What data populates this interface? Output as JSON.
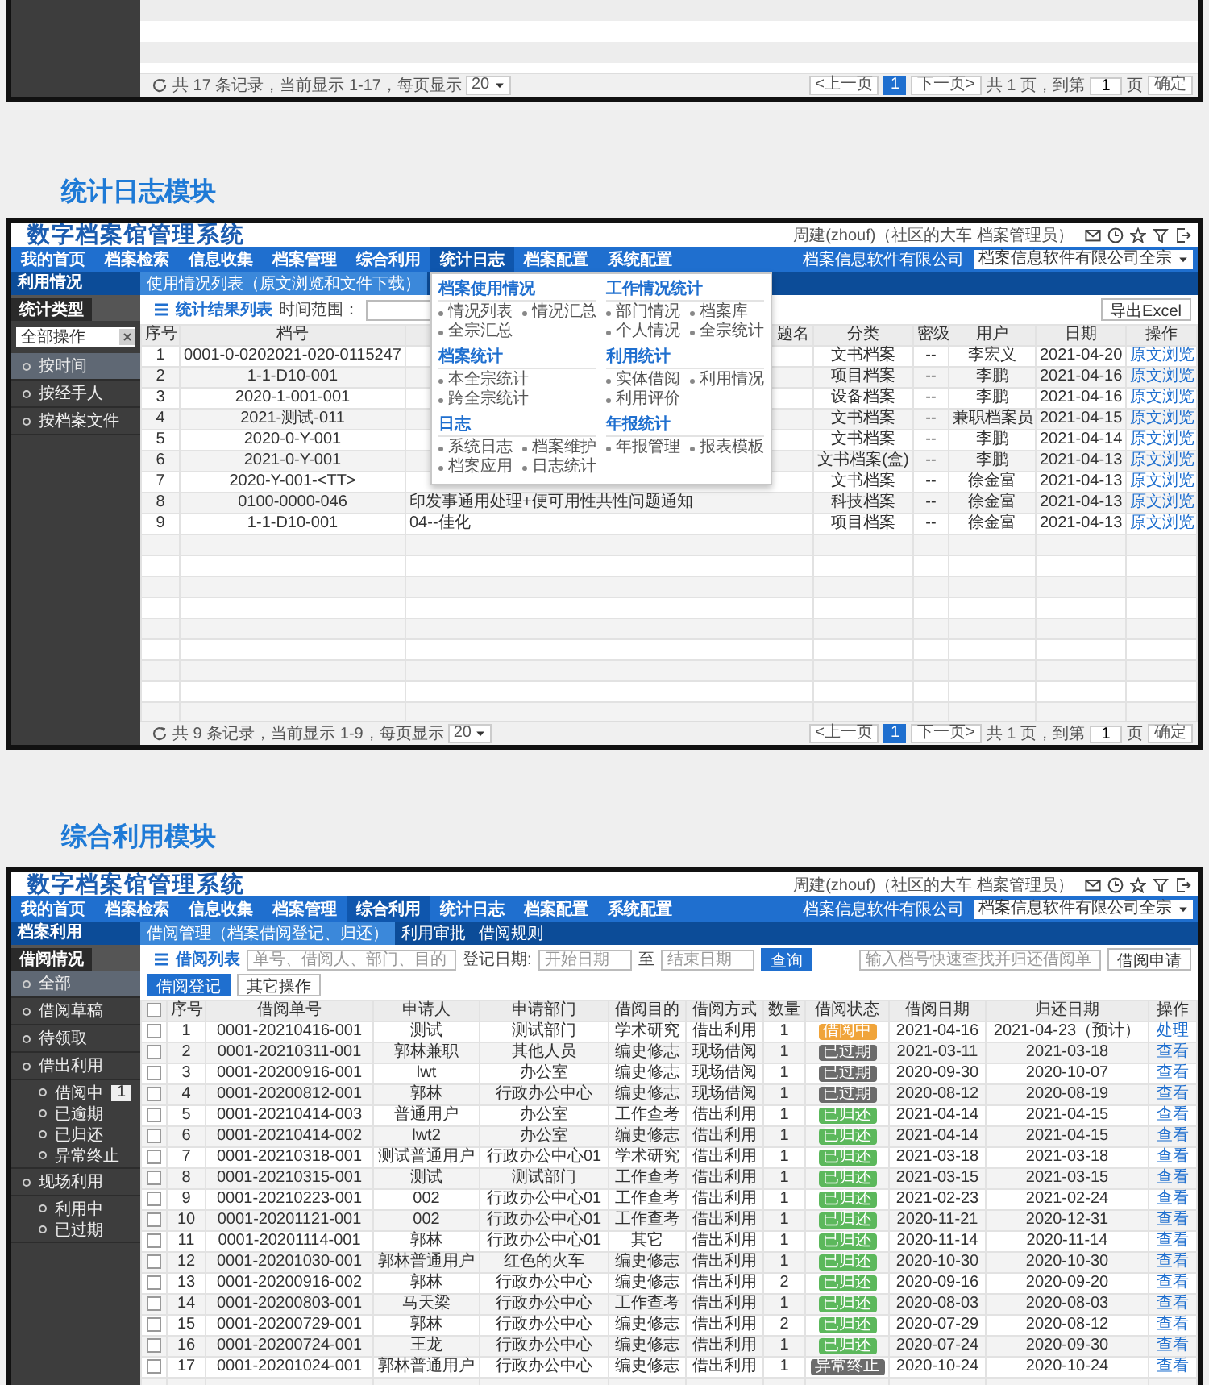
{
  "top_panel": {
    "footer": {
      "summary": "共 17 条记录，当前显示 1-17，每页显示",
      "page_size": "20",
      "prev": "<上一页",
      "pages": [
        {
          "label": "1",
          "selected": true
        }
      ],
      "next": "下一页>",
      "total": "共 1 页，到第",
      "goto": "1",
      "unit": "页",
      "confirm": "确定"
    }
  },
  "sections": [
    {
      "heading": "统计日志模块",
      "app": {
        "kind": "log",
        "title": "数字档案馆管理系统",
        "user": "周建(zhouf)（社区的大车 档案管理员）",
        "nav": [
          {
            "label": "我的首页",
            "selected": false
          },
          {
            "label": "档案检索",
            "selected": false
          },
          {
            "label": "信息收集",
            "selected": false
          },
          {
            "label": "档案管理",
            "selected": false
          },
          {
            "label": "综合利用",
            "selected": false
          },
          {
            "label": "统计日志",
            "selected": true
          },
          {
            "label": "档案配置",
            "selected": false
          },
          {
            "label": "系统配置",
            "selected": false
          }
        ],
        "company": "档案信息软件有限公司",
        "unit": "档案信息软件有限公司全宗",
        "module": "利用情况",
        "subtabs": [
          {
            "label": "使用情况列表（原文浏览和文件下载）",
            "selected": true
          }
        ],
        "menu": {
          "sections": [
            {
              "title": "档案使用情况",
              "items": [
                "情况列表",
                "情况汇总",
                "全宗汇总"
              ]
            },
            {
              "title": "工作情况统计",
              "items": [
                "部门情况",
                "档案库",
                "个人情况",
                "全宗统计"
              ]
            },
            {
              "title": "档案统计",
              "items": [
                "本全宗统计",
                "跨全宗统计"
              ]
            },
            {
              "title": "利用统计",
              "items": [
                "实体借阅",
                "利用情况",
                "利用评价"
              ]
            },
            {
              "title": "日志",
              "items": [
                "系统日志",
                "档案维护",
                "档案应用",
                "日志统计"
              ]
            },
            {
              "title": "年报统计",
              "items": [
                "年报管理",
                "报表模板"
              ]
            }
          ]
        },
        "sidebar": {
          "tab": "统计类型",
          "select": "全部操作",
          "items": [
            {
              "label": "按时间",
              "selected": true
            },
            {
              "label": "按经手人",
              "selected": false
            },
            {
              "label": "按档案文件",
              "selected": false
            }
          ]
        },
        "toolbar": {
          "list_title": "统计结果列表",
          "range_label": "时间范围：",
          "export": "导出Excel"
        },
        "table": {
          "columns": [
            "序号",
            "档号",
            "题名",
            "分类",
            "密级",
            "用户",
            "日期",
            "操作"
          ],
          "rows": [
            {
              "no": "1",
              "code": "0001-0-0202021-020-0115247",
              "category": "文书档案",
              "level": "--",
              "user": "李宏义",
              "date": "2021-04-20",
              "action": "原文浏览"
            },
            {
              "no": "2",
              "code": "1-1-D10-001",
              "category": "项目档案",
              "level": "--",
              "user": "李鹏",
              "date": "2021-04-16",
              "action": "原文浏览"
            },
            {
              "no": "3",
              "code": "2020-1-001-001",
              "category": "设备档案",
              "level": "--",
              "user": "李鹏",
              "date": "2021-04-16",
              "action": "原文浏览"
            },
            {
              "no": "4",
              "code": "2021-测试-011",
              "category": "文书档案",
              "level": "--",
              "user": "兼职档案员",
              "date": "2021-04-15",
              "action": "原文浏览"
            },
            {
              "no": "5",
              "code": "2020-0-Y-001",
              "category": "文书档案",
              "level": "--",
              "user": "李鹏",
              "date": "2021-04-14",
              "action": "原文浏览"
            },
            {
              "no": "6",
              "code": "2021-0-Y-001",
              "category": "文书档案(盒)",
              "level": "--",
              "user": "李鹏",
              "date": "2021-04-13",
              "action": "原文浏览"
            },
            {
              "no": "7",
              "code": "2020-Y-001-<TT>",
              "category": "文书档案",
              "level": "--",
              "user": "徐金富",
              "date": "2021-04-13",
              "action": "原文浏览"
            },
            {
              "no": "8",
              "code": "0100-0000-046",
              "title": "印发事通用处理+便可用性共性问题通知",
              "category": "科技档案",
              "level": "--",
              "user": "徐金富",
              "date": "2021-04-13",
              "action": "原文浏览"
            },
            {
              "no": "9",
              "code": "1-1-D10-001",
              "title": "04--佳化",
              "category": "项目档案",
              "level": "--",
              "user": "徐金富",
              "date": "2021-04-13",
              "action": "原文浏览"
            }
          ]
        },
        "footer": {
          "summary": "共 9 条记录，当前显示 1-9，每页显示",
          "page_size": "20",
          "prev": "<上一页",
          "pages": [
            {
              "label": "1",
              "selected": true
            }
          ],
          "next": "下一页>",
          "total": "共 1 页，到第",
          "goto": "1",
          "unit": "页",
          "confirm": "确定"
        }
      }
    },
    {
      "heading": "综合利用模块",
      "app": {
        "kind": "borrow",
        "title": "数字档案馆管理系统",
        "user": "周建(zhouf)（社区的大车 档案管理员）",
        "nav": [
          {
            "label": "我的首页",
            "selected": false
          },
          {
            "label": "档案检索",
            "selected": false
          },
          {
            "label": "信息收集",
            "selected": false
          },
          {
            "label": "档案管理",
            "selected": false
          },
          {
            "label": "综合利用",
            "selected": true
          },
          {
            "label": "统计日志",
            "selected": false
          },
          {
            "label": "档案配置",
            "selected": false
          },
          {
            "label": "系统配置",
            "selected": false
          }
        ],
        "company": "档案信息软件有限公司",
        "unit": "档案信息软件有限公司全宗",
        "module": "档案利用",
        "subtabs": [
          {
            "label": "借阅管理（档案借阅登记、归还）",
            "selected": true
          },
          {
            "label": "利用审批",
            "selected": false
          },
          {
            "label": "借阅规则",
            "selected": false
          }
        ],
        "sidebar": {
          "tab": "借阅情况",
          "items": [
            {
              "label": "全部",
              "selected": true
            },
            {
              "label": "借阅草稿",
              "selected": false
            },
            {
              "label": "待领取",
              "selected": false
            },
            {
              "label": "借出利用",
              "selected": false,
              "children": [
                {
                  "label": "借阅中",
                  "selected": false,
                  "badge": "1"
                },
                {
                  "label": "已逾期",
                  "selected": false
                },
                {
                  "label": "已归还",
                  "selected": false
                },
                {
                  "label": "异常终止",
                  "selected": false
                }
              ]
            },
            {
              "label": "现场利用",
              "selected": false,
              "children": [
                {
                  "label": "利用中",
                  "selected": false
                },
                {
                  "label": "已过期",
                  "selected": false
                }
              ]
            }
          ]
        },
        "toolbar": {
          "list_title": "借阅列表",
          "search_placeholder": "单号、借阅人、部门、目的",
          "date_label": "登记日期:",
          "start_placeholder": "开始日期",
          "to": "至",
          "end_placeholder": "结束日期",
          "query": "查询",
          "quick_placeholder": "输入档号快速查找并归还借阅单",
          "apply": "借阅申请",
          "register": "借阅登记",
          "more": "其它操作"
        },
        "table": {
          "select_all": false,
          "columns": [
            "序号",
            "借阅单号",
            "申请人",
            "申请部门",
            "借阅目的",
            "借阅方式",
            "数量",
            "借阅状态",
            "借阅日期",
            "归还日期",
            "操作"
          ],
          "rows": [
            {
              "checked": false,
              "no": "1",
              "code": "0001-20210416-001",
              "applicant": "测试",
              "dept": "测试部门",
              "purpose": "学术研究",
              "mode": "借出利用",
              "qty": "1",
              "status": {
                "text": "借阅中",
                "color": "#f0a43a"
              },
              "borrowed": "2021-04-16",
              "returned": "2021-04-23（预计）",
              "action": "处理"
            },
            {
              "checked": false,
              "no": "2",
              "code": "0001-20210311-001",
              "applicant": "郭林兼职",
              "dept": "其他人员",
              "purpose": "编史修志",
              "mode": "现场借阅",
              "qty": "1",
              "status": {
                "text": "已过期",
                "color": "#6b6b6b"
              },
              "borrowed": "2021-03-11",
              "returned": "2021-03-18",
              "action": "查看"
            },
            {
              "checked": false,
              "no": "3",
              "code": "0001-20200916-001",
              "applicant": "lwt",
              "dept": "办公室",
              "purpose": "编史修志",
              "mode": "现场借阅",
              "qty": "1",
              "status": {
                "text": "已过期",
                "color": "#6b6b6b"
              },
              "borrowed": "2020-09-30",
              "returned": "2020-10-07",
              "action": "查看"
            },
            {
              "checked": false,
              "no": "4",
              "code": "0001-20200812-001",
              "applicant": "郭林",
              "dept": "行政办公中心",
              "purpose": "编史修志",
              "mode": "现场借阅",
              "qty": "1",
              "status": {
                "text": "已过期",
                "color": "#6b6b6b"
              },
              "borrowed": "2020-08-12",
              "returned": "2020-08-19",
              "action": "查看"
            },
            {
              "checked": false,
              "no": "5",
              "code": "0001-20210414-003",
              "applicant": "普通用户",
              "dept": "办公室",
              "purpose": "工作查考",
              "mode": "借出利用",
              "qty": "1",
              "status": {
                "text": "已归还",
                "color": "#5cb85c"
              },
              "borrowed": "2021-04-14",
              "returned": "2021-04-15",
              "action": "查看"
            },
            {
              "checked": false,
              "no": "6",
              "code": "0001-20210414-002",
              "applicant": "lwt2",
              "dept": "办公室",
              "purpose": "编史修志",
              "mode": "借出利用",
              "qty": "1",
              "status": {
                "text": "已归还",
                "color": "#5cb85c"
              },
              "borrowed": "2021-04-14",
              "returned": "2021-04-15",
              "action": "查看"
            },
            {
              "checked": false,
              "no": "7",
              "code": "0001-20210318-001",
              "applicant": "测试普通用户",
              "dept": "行政办公中心01",
              "purpose": "学术研究",
              "mode": "借出利用",
              "qty": "1",
              "status": {
                "text": "已归还",
                "color": "#5cb85c"
              },
              "borrowed": "2021-03-18",
              "returned": "2021-03-18",
              "action": "查看"
            },
            {
              "checked": false,
              "no": "8",
              "code": "0001-20210315-001",
              "applicant": "测试",
              "dept": "测试部门",
              "purpose": "工作查考",
              "mode": "借出利用",
              "qty": "1",
              "status": {
                "text": "已归还",
                "color": "#5cb85c"
              },
              "borrowed": "2021-03-15",
              "returned": "2021-03-15",
              "action": "查看"
            },
            {
              "checked": false,
              "no": "9",
              "code": "0001-20210223-001",
              "applicant": "002",
              "dept": "行政办公中心01",
              "purpose": "工作查考",
              "mode": "借出利用",
              "qty": "1",
              "status": {
                "text": "已归还",
                "color": "#5cb85c"
              },
              "borrowed": "2021-02-23",
              "returned": "2021-02-24",
              "action": "查看"
            },
            {
              "checked": false,
              "no": "10",
              "code": "0001-20201121-001",
              "applicant": "002",
              "dept": "行政办公中心01",
              "purpose": "工作查考",
              "mode": "借出利用",
              "qty": "1",
              "status": {
                "text": "已归还",
                "color": "#5cb85c"
              },
              "borrowed": "2020-11-21",
              "returned": "2020-12-31",
              "action": "查看"
            },
            {
              "checked": false,
              "no": "11",
              "code": "0001-20201114-001",
              "applicant": "郭林",
              "dept": "行政办公中心01",
              "purpose": "其它",
              "mode": "借出利用",
              "qty": "1",
              "status": {
                "text": "已归还",
                "color": "#5cb85c"
              },
              "borrowed": "2020-11-14",
              "returned": "2020-11-14",
              "action": "查看"
            },
            {
              "checked": false,
              "no": "12",
              "code": "0001-20201030-001",
              "applicant": "郭林普通用户",
              "dept": "红色的火车",
              "purpose": "编史修志",
              "mode": "借出利用",
              "qty": "1",
              "status": {
                "text": "已归还",
                "color": "#5cb85c"
              },
              "borrowed": "2020-10-30",
              "returned": "2020-10-30",
              "action": "查看"
            },
            {
              "checked": false,
              "no": "13",
              "code": "0001-20200916-002",
              "applicant": "郭林",
              "dept": "行政办公中心",
              "purpose": "编史修志",
              "mode": "借出利用",
              "qty": "2",
              "status": {
                "text": "已归还",
                "color": "#5cb85c"
              },
              "borrowed": "2020-09-16",
              "returned": "2020-09-20",
              "action": "查看"
            },
            {
              "checked": false,
              "no": "14",
              "code": "0001-20200803-001",
              "applicant": "马天梁",
              "dept": "行政办公中心",
              "purpose": "工作查考",
              "mode": "借出利用",
              "qty": "1",
              "status": {
                "text": "已归还",
                "color": "#5cb85c"
              },
              "borrowed": "2020-08-03",
              "returned": "2020-08-03",
              "action": "查看"
            },
            {
              "checked": false,
              "no": "15",
              "code": "0001-20200729-001",
              "applicant": "郭林",
              "dept": "行政办公中心",
              "purpose": "编史修志",
              "mode": "借出利用",
              "qty": "2",
              "status": {
                "text": "已归还",
                "color": "#5cb85c"
              },
              "borrowed": "2020-07-29",
              "returned": "2020-08-12",
              "action": "查看"
            },
            {
              "checked": false,
              "no": "16",
              "code": "0001-20200724-001",
              "applicant": "王龙",
              "dept": "行政办公中心",
              "purpose": "编史修志",
              "mode": "借出利用",
              "qty": "1",
              "status": {
                "text": "已归还",
                "color": "#5cb85c"
              },
              "borrowed": "2020-07-24",
              "returned": "2020-09-30",
              "action": "查看"
            },
            {
              "checked": false,
              "no": "17",
              "code": "0001-20201024-001",
              "applicant": "郭林普通用户",
              "dept": "行政办公中心",
              "purpose": "编史修志",
              "mode": "借出利用",
              "qty": "1",
              "status": {
                "text": "异常终止",
                "color": "#6b6b6b"
              },
              "borrowed": "2020-10-24",
              "returned": "2020-10-24",
              "action": "查看"
            }
          ]
        }
      }
    }
  ]
}
